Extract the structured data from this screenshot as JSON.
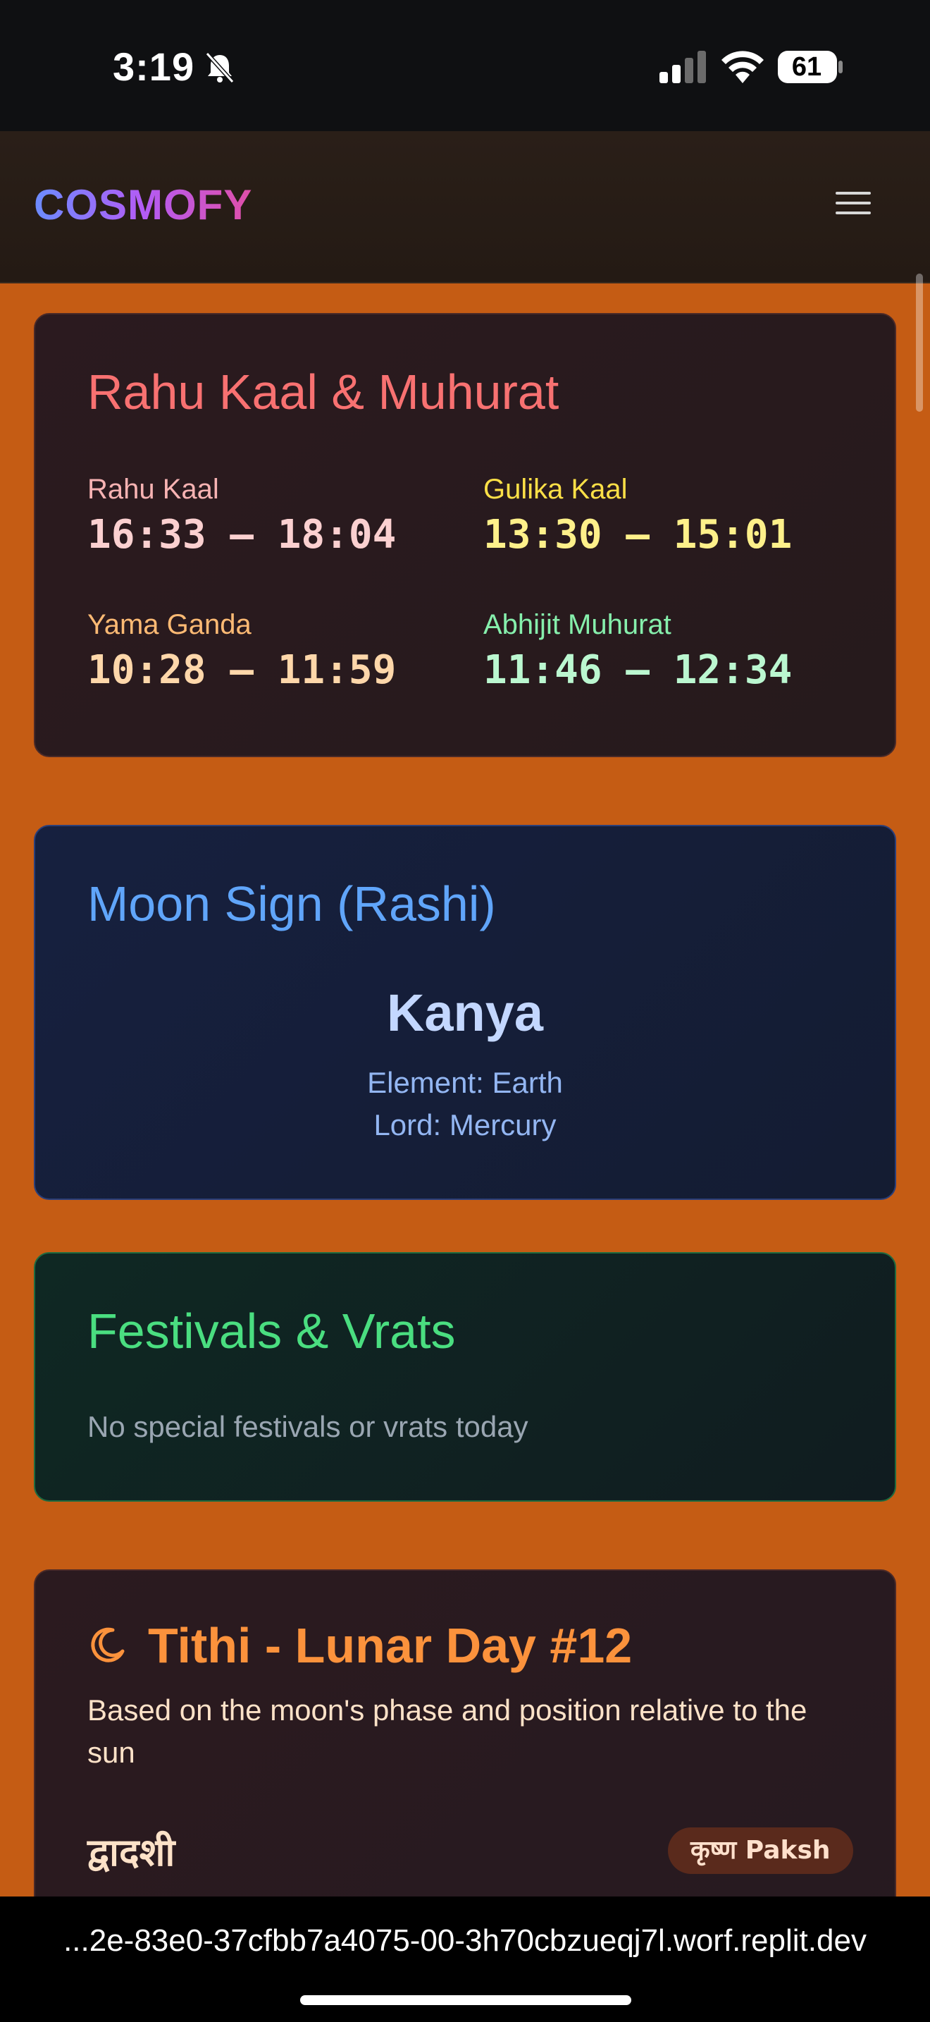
{
  "status_bar": {
    "time": "3:19",
    "battery": "61"
  },
  "header": {
    "logo": "COSMOFY"
  },
  "rahu_card": {
    "title": "Rahu Kaal & Muhurat",
    "items": [
      {
        "label": "Rahu Kaal",
        "value": "16:33 – 18:04",
        "label_color": "#f7b3b3",
        "value_color": "#fbd0d0"
      },
      {
        "label": "Gulika Kaal",
        "value": "13:30 – 15:01",
        "label_color": "#fde047",
        "value_color": "#fef08a"
      },
      {
        "label": "Yama Ganda",
        "value": "10:28 – 11:59",
        "label_color": "#fdba74",
        "value_color": "#fed7aa"
      },
      {
        "label": "Abhijit Muhurat",
        "value": "11:46 – 12:34",
        "label_color": "#86efac",
        "value_color": "#bbf7d0"
      }
    ]
  },
  "moon_card": {
    "title": "Moon Sign (Rashi)",
    "sign": "Kanya",
    "element": "Element: Earth",
    "lord": "Lord: Mercury"
  },
  "festival_card": {
    "title": "Festivals & Vrats",
    "message": "No special festivals or vrats today"
  },
  "tithi_card": {
    "title": "Tithi - Lunar Day #12",
    "description": "Based on the moon's phase and position relative to the sun",
    "tithi_name": "द्वादशी",
    "paksh": "कृष्ण Paksh"
  },
  "browser": {
    "url": "...2e-83e0-37cfbb7a4075-00-3h70cbzueqj7l.worf.replit.dev"
  }
}
